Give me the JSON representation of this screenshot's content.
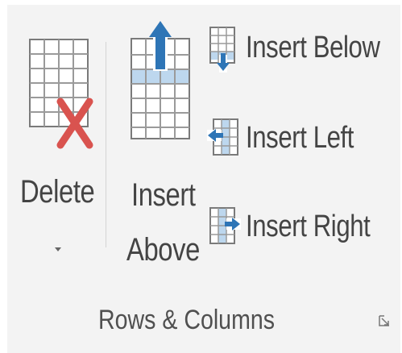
{
  "group": {
    "label": "Rows & Columns"
  },
  "buttons": {
    "delete": {
      "label": "Delete",
      "icon": "delete-table-icon",
      "has_dropdown": true
    },
    "insert_above": {
      "label_line1": "Insert",
      "label_line2": "Above",
      "icon": "insert-row-above-icon"
    },
    "insert_below": {
      "label": "Insert Below",
      "icon": "insert-row-below-icon"
    },
    "insert_left": {
      "label": "Insert Left",
      "icon": "insert-column-left-icon"
    },
    "insert_right": {
      "label": "Insert Right",
      "icon": "insert-column-right-icon"
    }
  },
  "dialog_launcher": {
    "icon": "dialog-launcher-icon"
  },
  "colors": {
    "background": "#f3f3f3",
    "text": "#444444",
    "grid_stroke": "#7a7a7a",
    "accent_blue": "#2e75b6",
    "highlight_row": "#bdd7ee",
    "delete_red": "#d9534f"
  }
}
